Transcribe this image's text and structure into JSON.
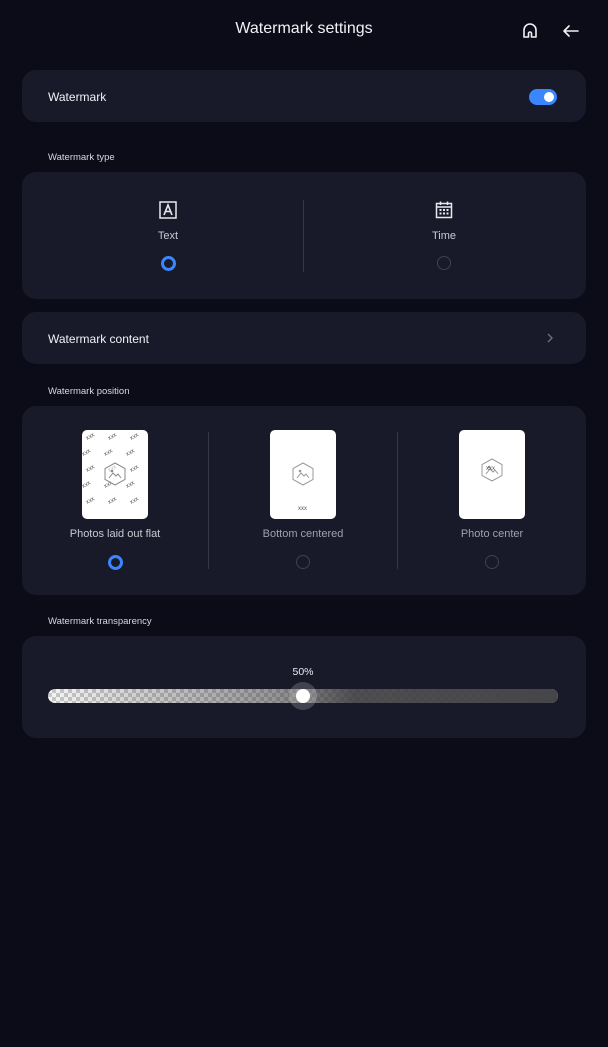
{
  "header": {
    "title": "Watermark settings",
    "home_icon": "home-icon",
    "back_icon": "back-arrow-icon"
  },
  "watermark_toggle": {
    "label": "Watermark",
    "enabled": true
  },
  "type_section": {
    "label": "Watermark type",
    "options": [
      {
        "label": "Text",
        "icon": "text-box-icon",
        "selected": true
      },
      {
        "label": "Time",
        "icon": "calendar-icon",
        "selected": false
      }
    ]
  },
  "content_row": {
    "label": "Watermark content",
    "chevron": "chevron-right-icon"
  },
  "position_section": {
    "label": "Watermark position",
    "thumb_text": "xxx",
    "options": [
      {
        "label": "Photos laid out flat",
        "selected": true
      },
      {
        "label": "Bottom centered",
        "selected": false
      },
      {
        "label": "Photo center",
        "selected": false
      }
    ]
  },
  "transparency_section": {
    "label": "Watermark transparency",
    "value_text": "50%",
    "value": 0.5
  },
  "colors": {
    "accent": "#3a86ff",
    "background": "#0b0c18",
    "card": "#181a29"
  }
}
